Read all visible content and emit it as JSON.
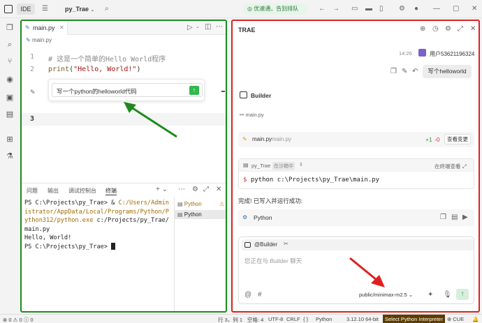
{
  "topbar": {
    "ide_label": "IDE",
    "project": "py_Trae",
    "promo": "优速通，告别排队"
  },
  "editor": {
    "tab": "main.py",
    "breadcrumb": "main.py",
    "lines": [
      {
        "num": "1",
        "text": "# 这是一个简单的Hello World程序"
      },
      {
        "num": "2",
        "fn": "print",
        "arg": "\"Hello, World!\""
      },
      {
        "num": "3",
        "text": ""
      }
    ],
    "inline_prompt": "写一个python的helloworld代码"
  },
  "panel": {
    "tabs": [
      "问题",
      "输出",
      "调试控制台",
      "终端"
    ],
    "active_tab": "终端",
    "terminal": [
      "PS C:\\Projects\\py_Trae> & ",
      "C:/Users/Administrator/AppData/Local/Programs/Python/Python312/python.exe",
      " c:/Projects/py_Trae/main.py",
      "Hello, World!",
      "PS C:\\Projects\\py_Trae> "
    ],
    "sessions": [
      "Python",
      "Python"
    ]
  },
  "trae": {
    "title": "TRAE",
    "time": "14:26",
    "user": "用户53621196324",
    "user_msg": "写个helloworld",
    "builder": "Builder",
    "file_ref": "main.py",
    "change_file": "main.py",
    "change_path": "main.py",
    "added": "+1",
    "removed": "-0",
    "view_changes": "查看变更",
    "terminal_project": "py_Trae",
    "sandbox": "在沙箱中",
    "run_in_terminal": "在终端查看",
    "command": "python c:\\Projects\\py_Trae\\main.py",
    "done_msg": "完成! 已写入并运行成功:",
    "code_lang": "Python",
    "agent_tag": "@Builder",
    "chat_placeholder": "您正在与 Builder 聊天",
    "model": "public/minimax-m2.5"
  },
  "status": {
    "errors": "0",
    "warnings": "0",
    "info": "0",
    "position": "行 3，列 1",
    "spaces": "空格: 4",
    "encoding": "UTF-8",
    "eol": "CRLF",
    "language": "Python",
    "interpreter": "3.12.10 64-bit",
    "select_interpreter": "Select Python Interpreter",
    "cue": "CUE"
  }
}
